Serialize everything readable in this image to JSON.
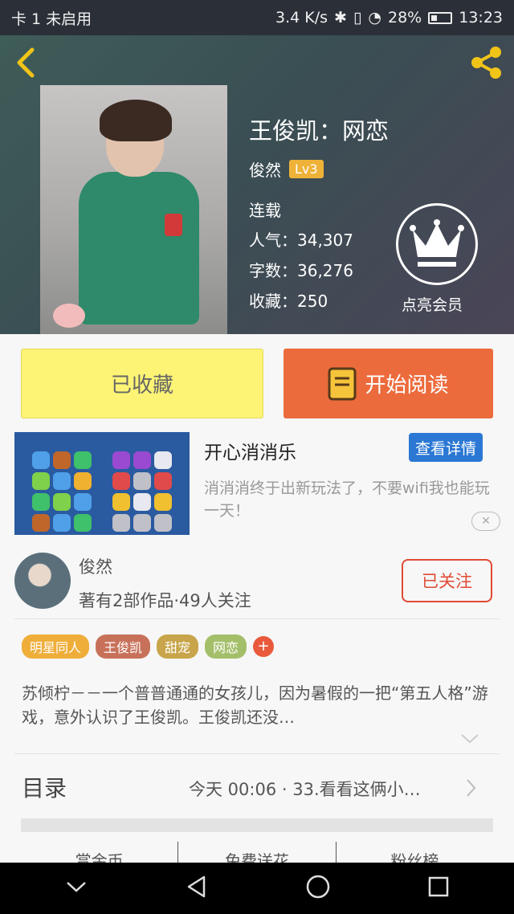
{
  "status_bar": {
    "carrier": "卡 1 未启用",
    "speed": "3.4 K/s",
    "battery": "28%",
    "time": "13:23"
  },
  "book": {
    "title": "王俊凯：网恋",
    "author": "俊然",
    "level": "Lv3",
    "status": "连载",
    "popularity": "人气：34,307",
    "word_count": "字数：36,276",
    "favorites": "收藏：250"
  },
  "vip": {
    "label": "点亮会员"
  },
  "actions": {
    "saved_label": "已收藏",
    "read_label": "开始阅读"
  },
  "ad": {
    "title": "开心消消乐",
    "detail_label": "查看详情",
    "description": "消消消终于出新玩法了，不要wifi我也能玩一天！"
  },
  "author_card": {
    "name": "俊然",
    "info": "著有2部作品·49人关注",
    "follow_label": "已关注"
  },
  "tags": [
    {
      "label": "明星同人",
      "color": "#efae3a"
    },
    {
      "label": "王俊凯",
      "color": "#c8715a"
    },
    {
      "label": "甜宠",
      "color": "#c8a54a"
    },
    {
      "label": "网恋",
      "color": "#a4bf6a"
    }
  ],
  "tag_add": "+",
  "summary": "苏倾柠－－一个普普通通的女孩儿，因为暑假的一把“第五人格”游戏，意外认识了王俊凯。王俊凯还没…",
  "toc": {
    "label": "目录",
    "latest": "今天 00:06 · 33.看看这俩小…"
  },
  "bottom_tabs": [
    "赏金币",
    "免费送花",
    "粉丝榜"
  ],
  "colors": {
    "accent_orange": "#ec6b3c",
    "saved_yellow": "#fdf475",
    "follow_red": "#e04a35",
    "ad_blue": "#2b78d4"
  }
}
